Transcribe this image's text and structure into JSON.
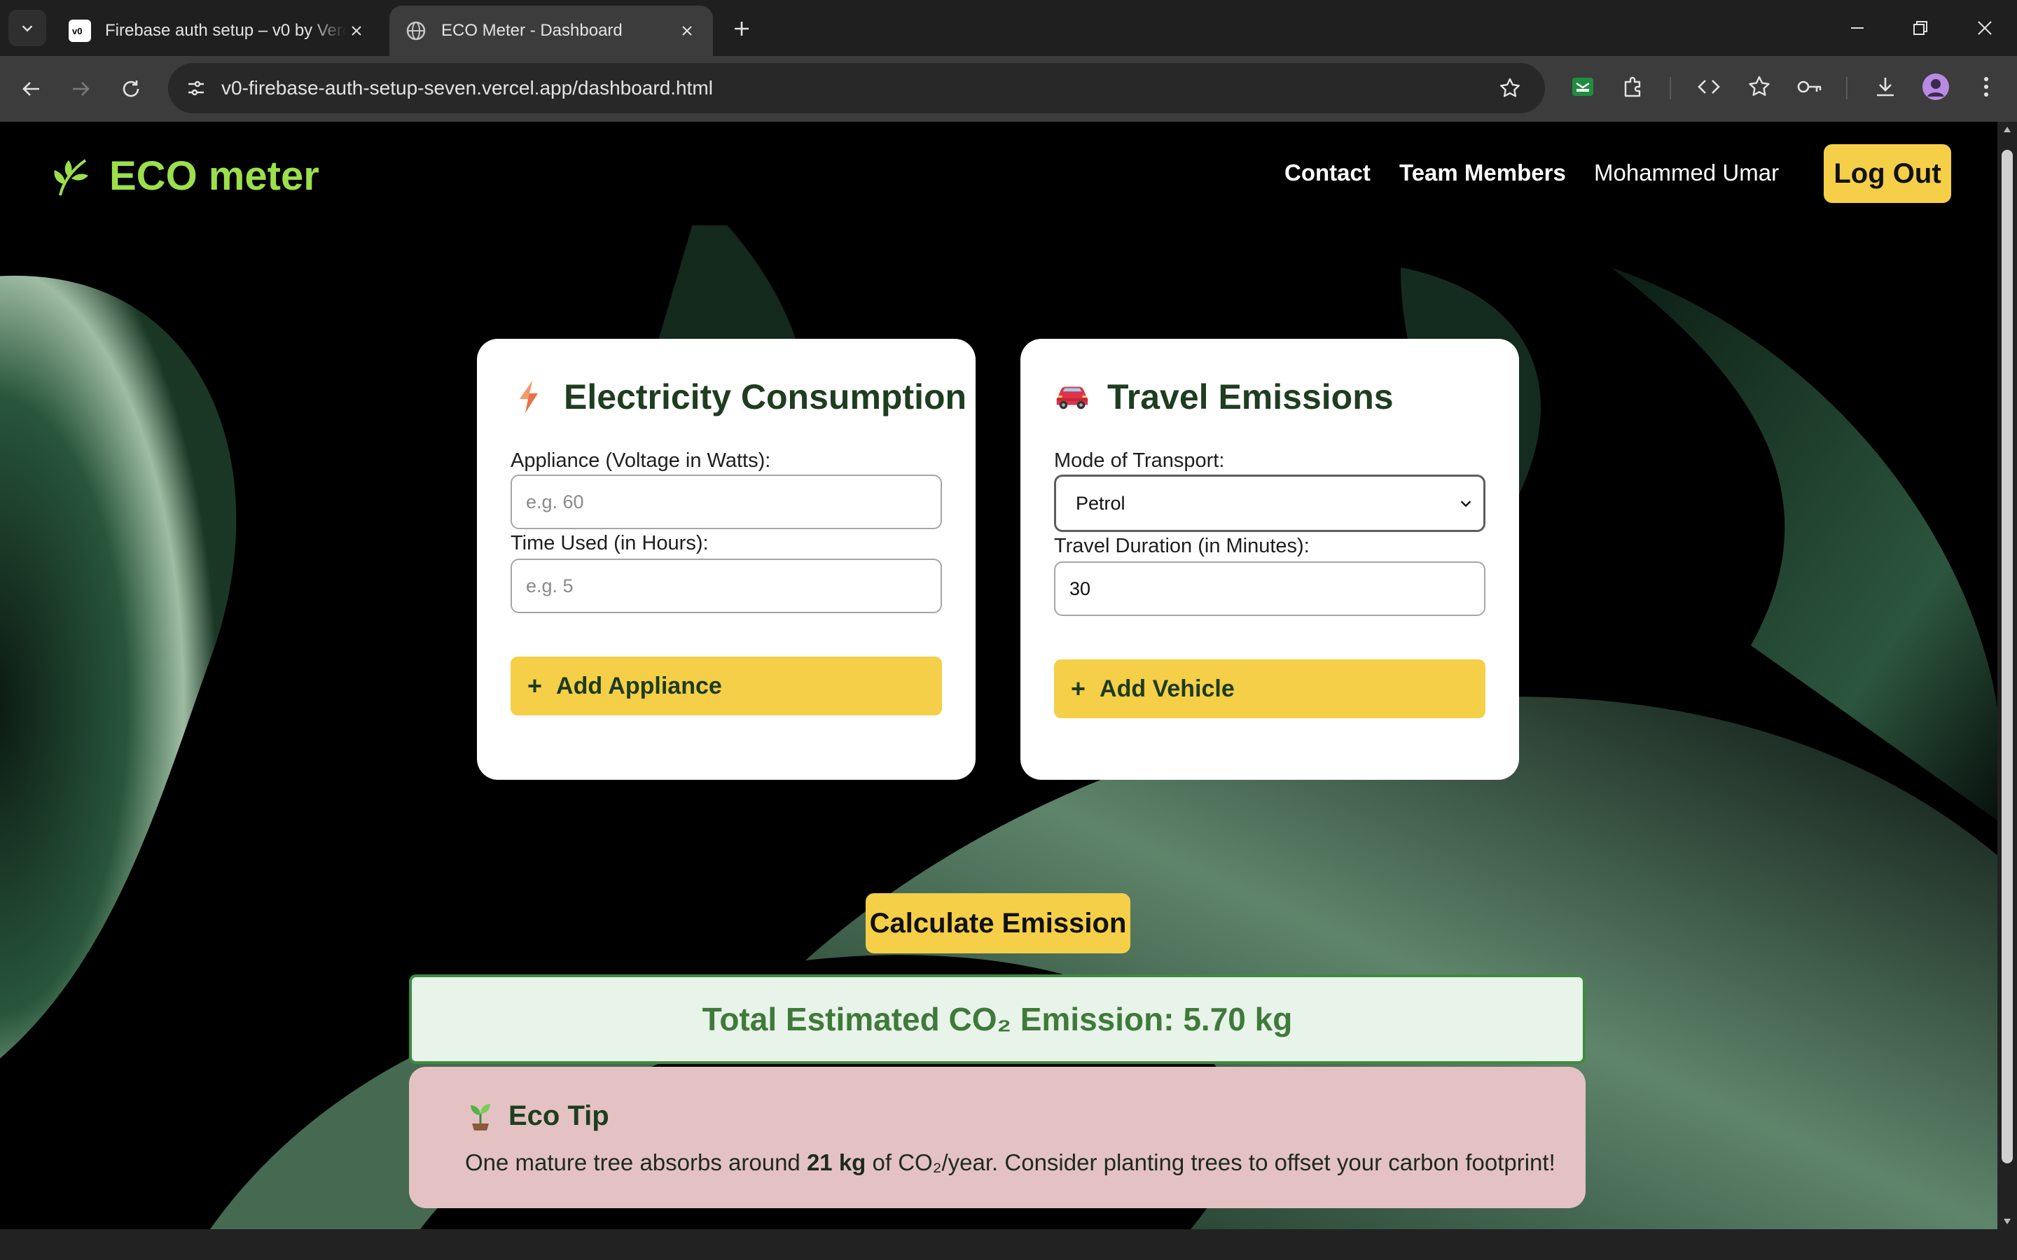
{
  "browser": {
    "tabs": [
      {
        "title": "Firebase auth setup – v0 by Vercel",
        "favicon": "v0-icon",
        "active": false
      },
      {
        "title": "ECO Meter - Dashboard",
        "favicon": "globe-icon",
        "active": true
      }
    ],
    "url": "v0-firebase-auth-setup-seven.vercel.app/dashboard.html"
  },
  "header": {
    "logo_text": "ECO meter",
    "logo_icon": "leaf-icon",
    "nav": {
      "contact": "Contact",
      "team": "Team Members",
      "user": "Mohammed Umar"
    },
    "logout_label": "Log Out"
  },
  "electricity": {
    "title": "Electricity Consumption",
    "icon": "lightning-icon",
    "appliance_label": "Appliance (Voltage in Watts):",
    "appliance_placeholder": "e.g. 60",
    "appliance_value": "",
    "time_label": "Time Used (in Hours):",
    "time_placeholder": "e.g. 5",
    "time_value": "",
    "add_label": "Add Appliance"
  },
  "travel": {
    "title": "Travel Emissions",
    "icon": "car-icon",
    "mode_label": "Mode of Transport:",
    "mode_value": "Petrol",
    "duration_label": "Travel Duration (in Minutes):",
    "duration_value": "30",
    "add_label": "Add Vehicle"
  },
  "calculate_label": "Calculate Emission",
  "result": {
    "text": "Total Estimated CO₂ Emission: 5.70 kg"
  },
  "eco_tip": {
    "title": "Eco Tip",
    "icon": "seedling-icon",
    "text_before": "One mature tree absorbs around ",
    "text_bold": "21 kg",
    "text_after": " of CO₂/year. Consider planting trees to offset your carbon footprint!"
  },
  "colors": {
    "brand_green": "#9be04a",
    "accent_yellow": "#f4cf47",
    "heading_green": "#1f3d20",
    "result_bg": "#e8f3e9",
    "result_border": "#3f8a3f",
    "tip_bg": "#e4c2c3"
  }
}
